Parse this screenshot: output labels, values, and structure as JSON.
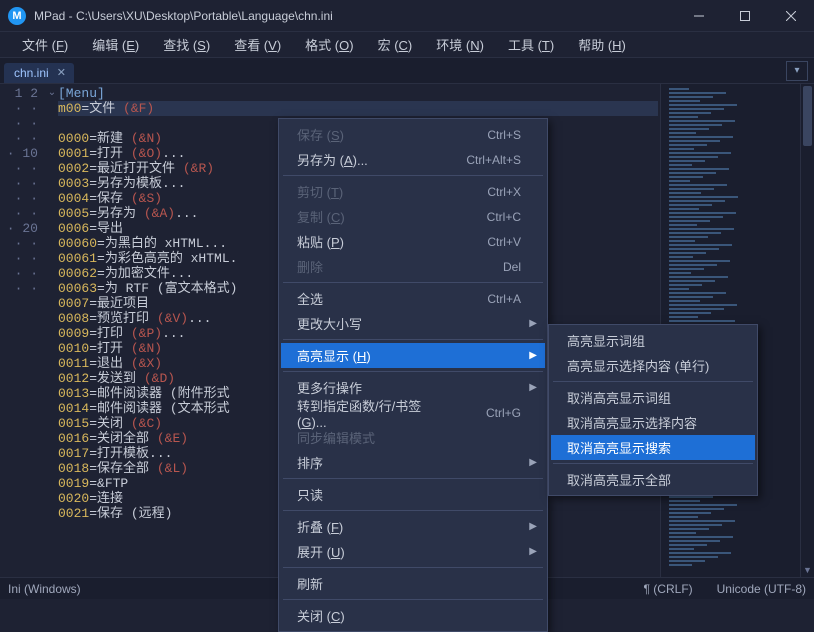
{
  "app_icon_letter": "M",
  "title": "MPad - C:\\Users\\XU\\Desktop\\Portable\\Language\\chn.ini",
  "menubar": [
    {
      "label": "文件",
      "key": "F"
    },
    {
      "label": "编辑",
      "key": "E"
    },
    {
      "label": "查找",
      "key": "S"
    },
    {
      "label": "查看",
      "key": "V"
    },
    {
      "label": "格式",
      "key": "O"
    },
    {
      "label": "宏",
      "key": "C"
    },
    {
      "label": "环境",
      "key": "N"
    },
    {
      "label": "工具",
      "key": "T"
    },
    {
      "label": "帮助",
      "key": "H"
    }
  ],
  "tab_label": "chn.ini",
  "code_lines": [
    {
      "n": "1",
      "fold": "⌄",
      "section": "[Menu]"
    },
    {
      "n": "2",
      "fold": "",
      "key": "m00",
      "val": "文件 ",
      "amp": "(&F)",
      "hl": true
    },
    {
      "n": "·",
      "fold": "",
      "key": "0000",
      "val": "新建 ",
      "amp": "(&N)"
    },
    {
      "n": "·",
      "fold": "",
      "key": "0001",
      "val": "打开 ",
      "amp": "(&O)",
      "tail": "..."
    },
    {
      "n": "·",
      "fold": "",
      "key": "0002",
      "val": "最近打开文件 ",
      "amp": "(&R)"
    },
    {
      "n": "·",
      "fold": "",
      "key": "0003",
      "val": "另存为模板...",
      "amp": ""
    },
    {
      "n": "·",
      "fold": "",
      "key": "0004",
      "val": "保存 ",
      "amp": "(&S)"
    },
    {
      "n": "·",
      "fold": "",
      "key": "0005",
      "val": "另存为 ",
      "amp": "(&A)",
      "tail": "..."
    },
    {
      "n": "·",
      "fold": "",
      "key": "0006",
      "val": "导出",
      "amp": ""
    },
    {
      "n": "10",
      "fold": "",
      "key": "00060",
      "val": "为黑白的 xHTML...",
      "amp": ""
    },
    {
      "n": "·",
      "fold": "",
      "key": "00061",
      "val": "为彩色高亮的 xHTML.",
      "amp": ""
    },
    {
      "n": "·",
      "fold": "",
      "key": "00062",
      "val": "为加密文件...",
      "amp": ""
    },
    {
      "n": "·",
      "fold": "",
      "key": "00063",
      "val": "为 RTF (富文本格式)",
      "amp": ""
    },
    {
      "n": "·",
      "fold": "",
      "key": "0007",
      "val": "最近项目",
      "amp": ""
    },
    {
      "n": "·",
      "fold": "",
      "key": "0008",
      "val": "预览打印 ",
      "amp": "(&V)",
      "tail": "..."
    },
    {
      "n": "·",
      "fold": "",
      "key": "0009",
      "val": "打印 ",
      "amp": "(&P)",
      "tail": "..."
    },
    {
      "n": "·",
      "fold": "",
      "key": "0010",
      "val": "打开 ",
      "amp": "(&N)"
    },
    {
      "n": "·",
      "fold": "",
      "key": "0011",
      "val": "退出 ",
      "amp": "(&X)"
    },
    {
      "n": "·",
      "fold": "",
      "key": "0012",
      "val": "发送到 ",
      "amp": "(&D)"
    },
    {
      "n": "20",
      "fold": "",
      "key": "0013",
      "val": "邮件阅读器 (附件形式",
      "amp": ""
    },
    {
      "n": "·",
      "fold": "",
      "key": "0014",
      "val": "邮件阅读器 (文本形式",
      "amp": ""
    },
    {
      "n": "·",
      "fold": "",
      "key": "0015",
      "val": "关闭 ",
      "amp": "(&C)"
    },
    {
      "n": "·",
      "fold": "",
      "key": "0016",
      "val": "关闭全部 ",
      "amp": "(&E)"
    },
    {
      "n": "·",
      "fold": "",
      "key": "0017",
      "val": "打开模板...",
      "amp": ""
    },
    {
      "n": "·",
      "fold": "",
      "key": "0018",
      "val": "保存全部 ",
      "amp": "(&L)"
    },
    {
      "n": "·",
      "fold": "",
      "key": "0019",
      "val": "&FTP",
      "amp": ""
    },
    {
      "n": "·",
      "fold": "",
      "key": "0020",
      "val": "连接",
      "amp": ""
    },
    {
      "n": "·",
      "fold": "",
      "key": "0021",
      "val": "保存 (远程)",
      "amp": ""
    }
  ],
  "ctx1": [
    {
      "label": "保存",
      "key": "S",
      "shortcut": "Ctrl+S",
      "disabled": true
    },
    {
      "label": "另存为",
      "key": "A",
      "tail": "...",
      "shortcut": "Ctrl+Alt+S"
    },
    {
      "sep": true
    },
    {
      "label": "剪切",
      "key": "T",
      "shortcut": "Ctrl+X",
      "disabled": true
    },
    {
      "label": "复制",
      "key": "C",
      "shortcut": "Ctrl+C",
      "disabled": true
    },
    {
      "label": "粘贴",
      "key": "P",
      "shortcut": "Ctrl+V"
    },
    {
      "label": "删除",
      "shortcut": "Del",
      "disabled": true
    },
    {
      "sep": true
    },
    {
      "label": "全选",
      "shortcut": "Ctrl+A"
    },
    {
      "label": "更改大小写",
      "submenu": true
    },
    {
      "sep": true
    },
    {
      "label": "高亮显示",
      "key": "H",
      "submenu": true,
      "hl": true
    },
    {
      "sep": true
    },
    {
      "label": "更多行操作",
      "submenu": true
    },
    {
      "label": "转到指定函数/行/书签",
      "key": "G",
      "tail": "...",
      "shortcut": "Ctrl+G"
    },
    {
      "label": "同步编辑模式",
      "disabled": true
    },
    {
      "label": "排序",
      "submenu": true
    },
    {
      "sep": true
    },
    {
      "label": "只读"
    },
    {
      "sep": true
    },
    {
      "label": "折叠",
      "key": "F",
      "submenu": true
    },
    {
      "label": "展开",
      "key": "U",
      "submenu": true
    },
    {
      "sep": true
    },
    {
      "label": "刷新"
    },
    {
      "sep": true
    },
    {
      "label": "关闭",
      "key": "C"
    }
  ],
  "ctx2": [
    {
      "label": "高亮显示词组"
    },
    {
      "label": "高亮显示选择内容 (单行)"
    },
    {
      "sep": true
    },
    {
      "label": "取消高亮显示词组"
    },
    {
      "label": "取消高亮显示选择内容"
    },
    {
      "label": "取消高亮显示搜索",
      "hl": true
    },
    {
      "sep": true
    },
    {
      "label": "取消高亮显示全部"
    }
  ],
  "status": {
    "left": "Ini (Windows)",
    "lineend": "¶ (CRLF)",
    "encoding": "Unicode (UTF-8)"
  }
}
